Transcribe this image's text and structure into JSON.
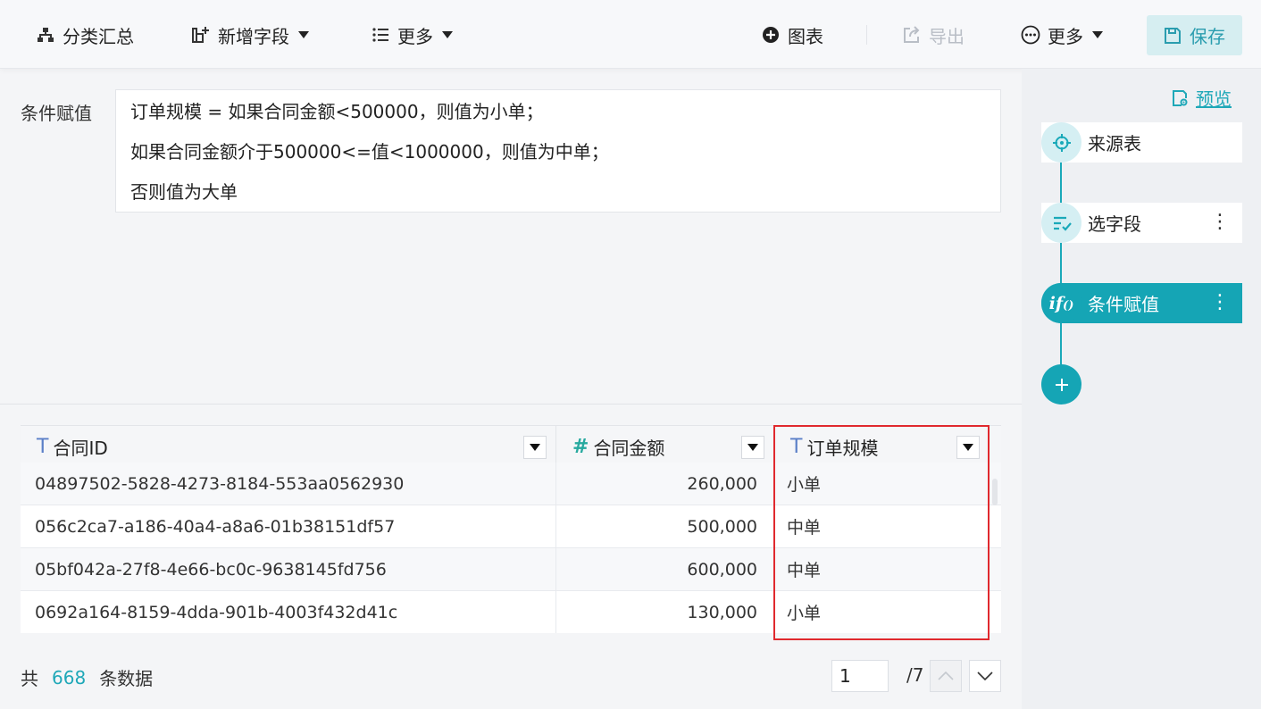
{
  "toolbar": {
    "group_summary": "分类汇总",
    "add_field": "新增字段",
    "more_left": "更多",
    "chart": "图表",
    "export": "导出",
    "more_right": "更多",
    "save": "保存"
  },
  "side": {
    "preview": "预览",
    "nodes": [
      {
        "label": "来源表",
        "icon": "target-icon"
      },
      {
        "label": "选字段",
        "icon": "select-fields-icon"
      },
      {
        "label": "条件赋值",
        "icon": "if-icon",
        "active": true
      }
    ]
  },
  "condition": {
    "label": "条件赋值",
    "lines": [
      "订单规模 = 如果合同金额<500000，则值为小单；",
      "如果合同金额介于500000<=值<1000000，则值为中单；",
      "否则值为大单"
    ]
  },
  "table": {
    "columns": [
      {
        "type_icon": "T",
        "name": "合同ID"
      },
      {
        "type_icon": "#",
        "name": "合同金额"
      },
      {
        "type_icon": "T",
        "name": "订单规模"
      }
    ],
    "rows": [
      {
        "id": "04897502-5828-4273-8184-553aa0562930",
        "amount": "260,000",
        "scale": "小单"
      },
      {
        "id": "056c2ca7-a186-40a4-a8a6-01b38151df57",
        "amount": "500,000",
        "scale": "中单"
      },
      {
        "id": "05bf042a-27f8-4e66-bc0c-9638145fd756",
        "amount": "600,000",
        "scale": "中单"
      },
      {
        "id": "0692a164-8159-4dda-901b-4003f432d41c",
        "amount": "130,000",
        "scale": "小单"
      }
    ]
  },
  "footer": {
    "total_prefix": "共",
    "total": "668",
    "total_suffix": "条数据",
    "page": "1",
    "page_total": "/7"
  },
  "colors": {
    "accent": "#15a5b5",
    "highlight": "#e0292e"
  }
}
